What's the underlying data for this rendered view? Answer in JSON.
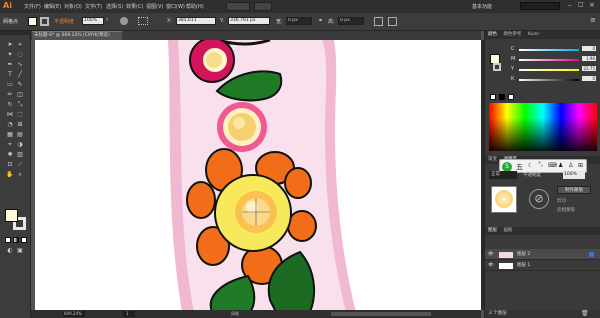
{
  "app": {
    "logo": "Ai",
    "workspace": "基本功能"
  },
  "menu": [
    "文件(F)",
    "编辑(E)",
    "对象(O)",
    "文字(T)",
    "选择(S)",
    "效果(C)",
    "视图(V)",
    "窗口(W)",
    "帮助(H)"
  ],
  "control": {
    "no_selection": "网格点",
    "fill_label": "不透明度",
    "opacity": "100%",
    "x_value": "385.611",
    "y_value": "336.791 px",
    "w_value": "0 px",
    "h_value": "0 px"
  },
  "document": {
    "tab_title": "未标题-8* @ 609.24% (CMYK/预览)",
    "zoom": "609.24%",
    "page": "1",
    "status_tool": "网格"
  },
  "panels": {
    "color_tabs": [
      "颜色",
      "颜色参考",
      "Kuler"
    ],
    "cmyk": [
      {
        "label": "C",
        "value": "0"
      },
      {
        "label": "M",
        "value": "1.96"
      },
      {
        "label": "Y",
        "value": "22.75"
      },
      {
        "label": "K",
        "value": "0"
      }
    ],
    "transparency_tabs": [
      "渐变",
      "透明度"
    ],
    "mode": "正常",
    "opacity_label": "不透明度",
    "opacity_value": "100%",
    "make_mask": "制作蒙版",
    "clip": "剪切",
    "invert_mask": "反相蒙版",
    "layers_tabs": [
      "图层",
      "画板"
    ],
    "layers": [
      "图层 2",
      "图层 1"
    ],
    "layers_count": "2 个图层"
  },
  "colors": {
    "accent": "#e6862b",
    "petal": "#f26d1a",
    "leaf": "#1a6b25",
    "shape": "#f7dcea",
    "magenta": "#d81b5e",
    "pink": "#ee5e94"
  }
}
